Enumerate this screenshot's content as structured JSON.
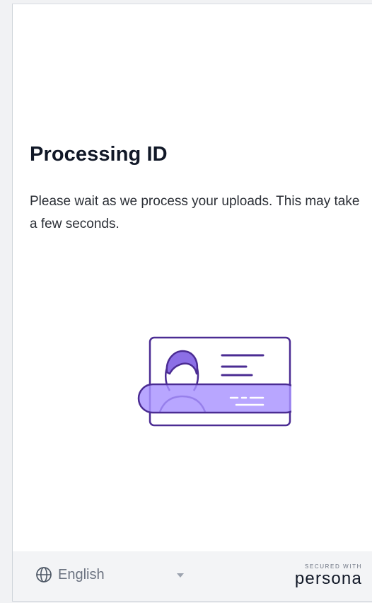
{
  "screen": {
    "title": "Processing ID",
    "description": "Please wait as we process your uploads. This may take a few seconds."
  },
  "illustration": {
    "icon": "id-card-scan-icon",
    "colors": {
      "stroke": "#4b2c93",
      "scan_band": "#a893ff",
      "card_fill": "#ffffff"
    }
  },
  "footer": {
    "language": {
      "icon": "globe-icon",
      "selected": "English",
      "dropdown_icon": "chevron-down-icon"
    },
    "secured_label": "SECURED WITH",
    "brand": "persona"
  }
}
